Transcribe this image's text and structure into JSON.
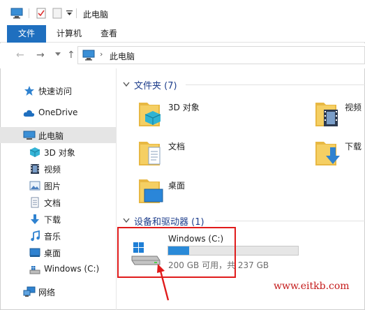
{
  "window": {
    "title": "此电脑",
    "quick_access_toolbar": [
      "computer-icon",
      "properties-icon",
      "new-folder-icon",
      "customize-dropdown-icon"
    ]
  },
  "ribbon": {
    "tabs": [
      {
        "label": "文件",
        "active": true
      },
      {
        "label": "计算机",
        "active": false
      },
      {
        "label": "查看",
        "active": false
      }
    ]
  },
  "address_bar": {
    "breadcrumb": [
      "此电脑"
    ]
  },
  "sidebar": {
    "items": [
      {
        "label": "快速访问",
        "icon": "star-icon"
      },
      {
        "label": "OneDrive",
        "icon": "cloud-icon"
      },
      {
        "label": "此电脑",
        "icon": "computer-icon",
        "selected": true
      },
      {
        "label": "3D 对象",
        "icon": "cube-icon"
      },
      {
        "label": "视频",
        "icon": "video-icon"
      },
      {
        "label": "图片",
        "icon": "picture-icon"
      },
      {
        "label": "文档",
        "icon": "document-icon"
      },
      {
        "label": "下载",
        "icon": "download-icon"
      },
      {
        "label": "音乐",
        "icon": "music-icon"
      },
      {
        "label": "桌面",
        "icon": "desktop-icon"
      },
      {
        "label": "Windows (C:)",
        "icon": "drive-icon"
      },
      {
        "label": "网络",
        "icon": "network-icon"
      }
    ]
  },
  "folders_group": {
    "heading": "文件夹 (7)",
    "items": [
      {
        "label": "3D 对象"
      },
      {
        "label": "视频"
      },
      {
        "label": "文档"
      },
      {
        "label": "下载"
      },
      {
        "label": "桌面"
      }
    ]
  },
  "drives_group": {
    "heading": "设备和驱动器 (1)",
    "drive": {
      "label": "Windows (C:)",
      "space_text": "200 GB 可用，共 237 GB",
      "used_fraction": 0.16
    }
  },
  "watermark": "www.eitkb.com",
  "colors": {
    "accent": "#1f6fbf",
    "folder": "#f2c14e",
    "heading": "#1e3e8c",
    "annotation": "#e01b1b",
    "progress": "#2a8ad8"
  }
}
